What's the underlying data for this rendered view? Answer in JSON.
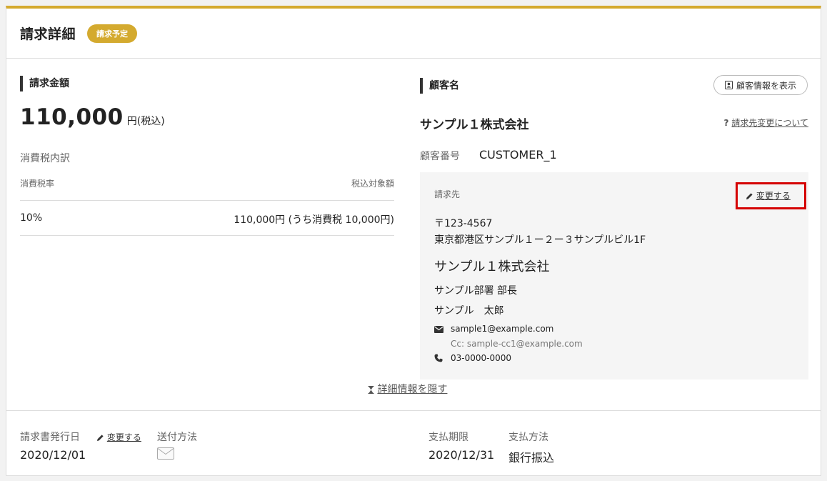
{
  "header": {
    "title": "請求詳細",
    "status": "請求予定"
  },
  "amount_section": {
    "label": "請求金額",
    "amount": "110,000",
    "unit": "円(税込)",
    "tax_breakdown_label": "消費税内訳",
    "table": {
      "columns": [
        "消費税率",
        "税込対象額"
      ],
      "rows": [
        {
          "rate": "10%",
          "amount": "110,000円 (うち消費税 10,000円)"
        }
      ]
    }
  },
  "customer_section": {
    "label": "顧客名",
    "show_info_button": "顧客情報を表示",
    "name": "サンプル１株式会社",
    "change_link": "請求先変更について",
    "number_label": "顧客番号",
    "number_value": "CUSTOMER_1"
  },
  "billing": {
    "label": "請求先",
    "change_button": "変更する",
    "postal": "〒123-4567",
    "address": "東京都港区サンプル１ー２ー３サンプルビル1F",
    "company": "サンプル１株式会社",
    "department": "サンプル部署 部長",
    "person": "サンプル　太郎",
    "email": "sample1@example.com",
    "cc": "Cc: sample-cc1@example.com",
    "phone": "03-0000-0000"
  },
  "toggle_details": "詳細情報を隠す",
  "footer": {
    "issue_date_label": "請求書発行日",
    "issue_date_change": "変更する",
    "issue_date": "2020/12/01",
    "send_method_label": "送付方法",
    "due_label": "支払期限",
    "due_date": "2020/12/31",
    "payment_label": "支払方法",
    "payment_method": "銀行振込"
  },
  "colors": {
    "accent": "#d4aa2f",
    "highlight": "#d50000"
  }
}
